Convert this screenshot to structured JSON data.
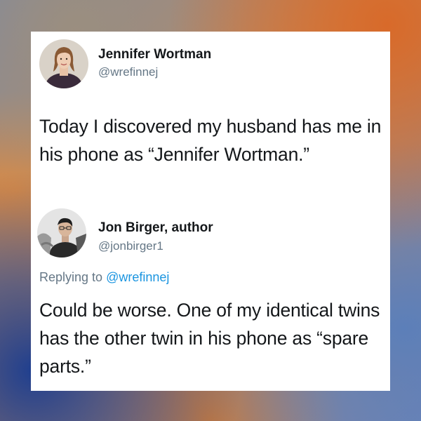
{
  "original_tweet": {
    "author_name": "Jennifer Wortman",
    "author_handle": "@wrefinnej",
    "text": "Today I discovered my husband has me in his phone as “Jennifer Wortman.”"
  },
  "reply_tweet": {
    "author_name": "Jon Birger, author",
    "author_handle": "@jonbirger1",
    "replying_prefix": "Replying to",
    "replying_handle": "@wrefinnej",
    "text": "Could be worse. One of my identical twins has the other twin in his phone as “spare parts.”"
  },
  "colors": {
    "text_primary": "#14171a",
    "text_secondary": "#657786",
    "mention": "#1b95e0",
    "card_background": "#ffffff"
  }
}
